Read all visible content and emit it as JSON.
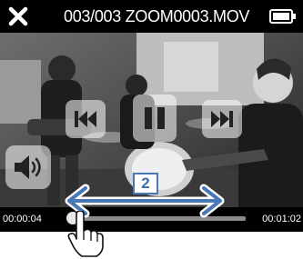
{
  "header": {
    "title": "003/003 ZOOM0003.MOV",
    "close_icon": "close-icon",
    "battery_icon": "battery-icon"
  },
  "controls": {
    "prev_icon": "skip-previous-icon",
    "play_pause_icon": "pause-icon",
    "next_icon": "skip-next-icon",
    "volume_icon": "speaker-icon"
  },
  "playback": {
    "current_time": "00:00:04",
    "total_time": "00:01:02",
    "progress": 0.065
  },
  "annotation": {
    "step_number": "2",
    "arrow_color": "#4a78b4",
    "gesture_icon": "hand-pointer-icon"
  }
}
